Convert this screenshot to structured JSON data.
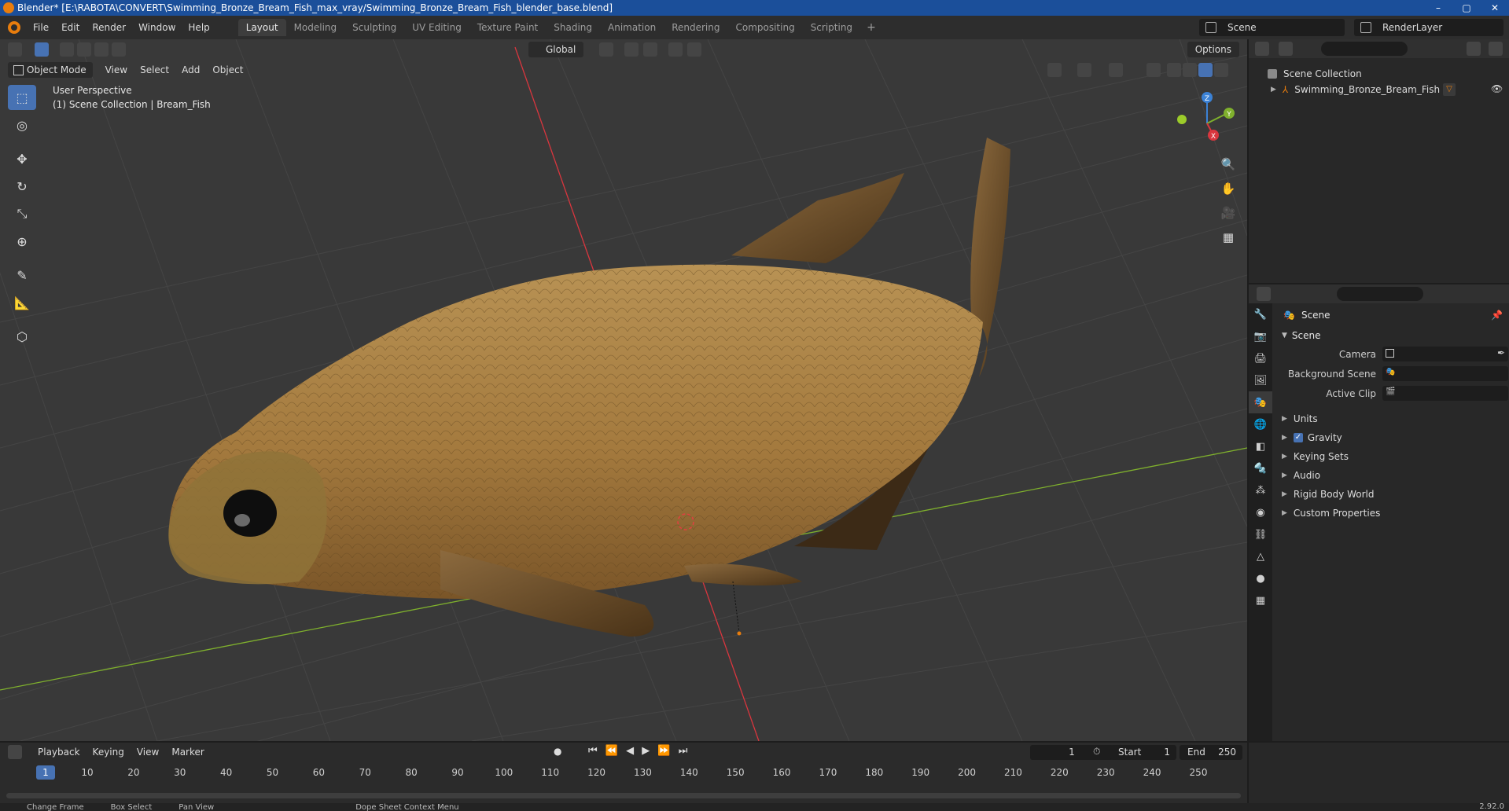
{
  "titlebar": {
    "title": "Blender* [E:\\RABOTA\\CONVERT\\Swimming_Bronze_Bream_Fish_max_vray/Swimming_Bronze_Bream_Fish_blender_base.blend]",
    "minimize": "–",
    "maximize": "▢",
    "close": "✕"
  },
  "menubar": {
    "items": [
      "File",
      "Edit",
      "Render",
      "Window",
      "Help"
    ],
    "workspaces": [
      "Layout",
      "Modeling",
      "Sculpting",
      "UV Editing",
      "Texture Paint",
      "Shading",
      "Animation",
      "Rendering",
      "Compositing",
      "Scripting"
    ],
    "active_workspace": "Layout",
    "add_workspace": "+",
    "scene": "Scene",
    "render_layer": "RenderLayer"
  },
  "viewport": {
    "mode": "Object Mode",
    "menus": [
      "View",
      "Select",
      "Add",
      "Object"
    ],
    "transform_orientation": "Global",
    "options": "Options",
    "perspective": "User Perspective",
    "collection_info": "(1) Scene Collection | Bream_Fish",
    "gizmo_axes": {
      "z": "Z",
      "y": "Y",
      "x": "X"
    }
  },
  "outliner": {
    "root": "Scene Collection",
    "object": "Swimming_Bronze_Bream_Fish"
  },
  "properties": {
    "title": "Scene",
    "panel": "Scene",
    "fields": [
      {
        "label": "Camera"
      },
      {
        "label": "Background Scene"
      },
      {
        "label": "Active Clip"
      }
    ],
    "subpanels": [
      "Units",
      "Gravity",
      "Keying Sets",
      "Audio",
      "Rigid Body World",
      "Custom Properties"
    ],
    "gravity_checked": true
  },
  "timeline": {
    "menus": [
      "Playback",
      "Keying",
      "View",
      "Marker"
    ],
    "current_frame": "1",
    "start_label": "Start",
    "start_value": "1",
    "end_label": "End",
    "end_value": "250",
    "ruler": [
      "1",
      "10",
      "20",
      "30",
      "40",
      "50",
      "60",
      "70",
      "80",
      "90",
      "100",
      "110",
      "120",
      "130",
      "140",
      "150",
      "160",
      "170",
      "180",
      "190",
      "200",
      "210",
      "220",
      "230",
      "240",
      "250"
    ]
  },
  "statusbar": {
    "items": [
      "Change Frame",
      "Box Select",
      "Pan View",
      "Dope Sheet Context Menu"
    ],
    "version": "2.92.0"
  },
  "colors": {
    "accent": "#4772b3",
    "brand": "#e87d0d",
    "axis_x": "#d9363e",
    "axis_y": "#7fb02d",
    "axis_z": "#3b82d6"
  }
}
